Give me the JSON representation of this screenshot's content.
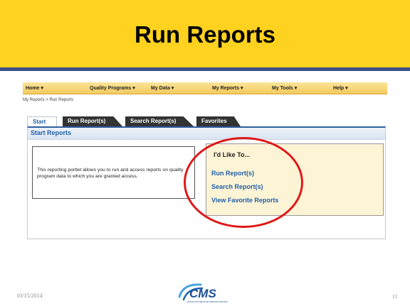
{
  "slide": {
    "title": "Run Reports",
    "date": "10/15/2014",
    "page_number": "13",
    "logo_text": "CMS",
    "logo_subtext": "CENTERS FOR MEDICARE & MEDICAID SERVICES",
    "header_bg": "#ffd21f",
    "header_rule": "#3c4f8a"
  },
  "portal": {
    "nav": [
      {
        "label": "Home ▾",
        "icon": "chevron-down-icon"
      },
      {
        "label": "Quality Programs ▾",
        "icon": "chevron-down-icon"
      },
      {
        "label": "My Data ▾",
        "icon": "chevron-down-icon"
      },
      {
        "label": "My Reports ▾",
        "icon": "chevron-down-icon"
      },
      {
        "label": "My Tools ▾",
        "icon": "chevron-down-icon"
      },
      {
        "label": "Help ▾",
        "icon": "chevron-down-icon"
      }
    ],
    "breadcrumb": "My Reports > Run Reports",
    "tabs": [
      {
        "label": "Start",
        "active": true
      },
      {
        "label": "Run Report(s)",
        "active": false
      },
      {
        "label": "Search Report(s)",
        "active": false
      },
      {
        "label": "Favorites",
        "active": false
      }
    ],
    "panel_title": "Start Reports",
    "description": "This reporting portlet allows you to run and access reports on quality program data to which you are granted access.",
    "like_heading": "I'd Like To...",
    "links": [
      "Run Report(s)",
      "Search Report(s)",
      "View Favorite Reports"
    ],
    "accent_color": "#1f5fa8",
    "highlight_color": "#e01818"
  }
}
